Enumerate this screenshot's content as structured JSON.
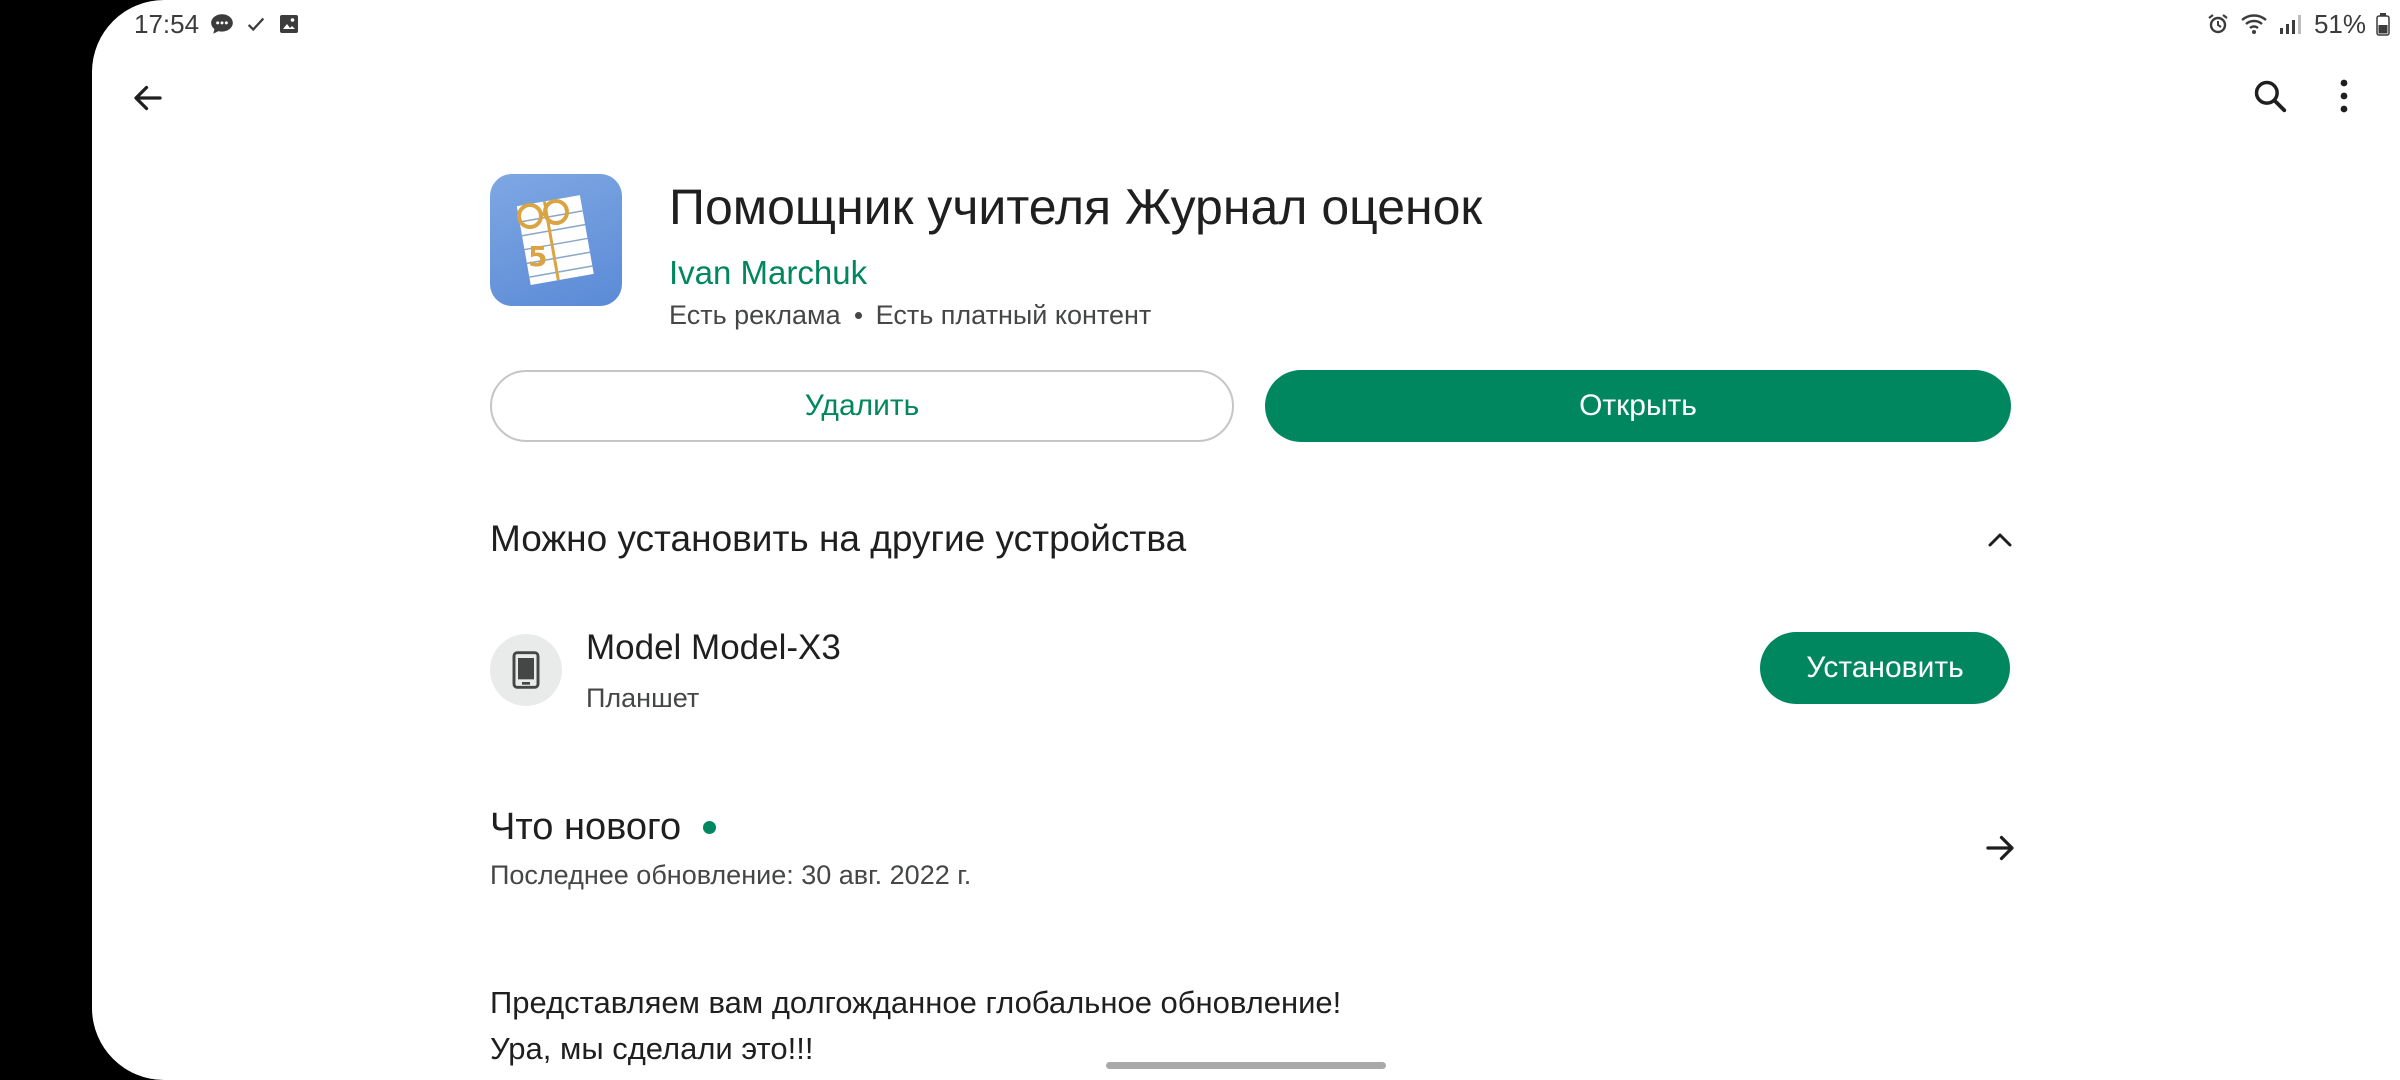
{
  "status_bar": {
    "time": "17:54",
    "battery": "51%",
    "left_icons": [
      "chat-icon",
      "check-icon",
      "gallery-icon"
    ],
    "right_icons": [
      "alarm-icon",
      "wifi-icon",
      "signal-icon",
      "battery-icon"
    ]
  },
  "toolbar": {
    "back_icon": "back-arrow-icon",
    "search_icon": "search-icon",
    "more_icon": "more-vert-icon"
  },
  "app": {
    "title": "Помощник учителя Журнал оценок",
    "developer": "Ivan Marchuk",
    "meta": [
      "Есть реклама",
      "Есть платный контент"
    ],
    "icon_grade": "5"
  },
  "actions": {
    "uninstall_label": "Удалить",
    "open_label": "Открыть"
  },
  "other_devices": {
    "title": "Можно установить на другие устройства",
    "device_name": "Model Model-X3",
    "device_type": "Планшет",
    "install_label": "Установить"
  },
  "whats_new": {
    "title": "Что нового",
    "last_update": "Последнее обновление: 30 авг. 2022 г.",
    "notes_line1": "Представляем вам долгожданное глобальное обновление!",
    "notes_line2": "Ура, мы сделали это!!!"
  },
  "colors": {
    "accent": "#01875f",
    "text": "#1f1f1f",
    "secondary": "#444746"
  }
}
